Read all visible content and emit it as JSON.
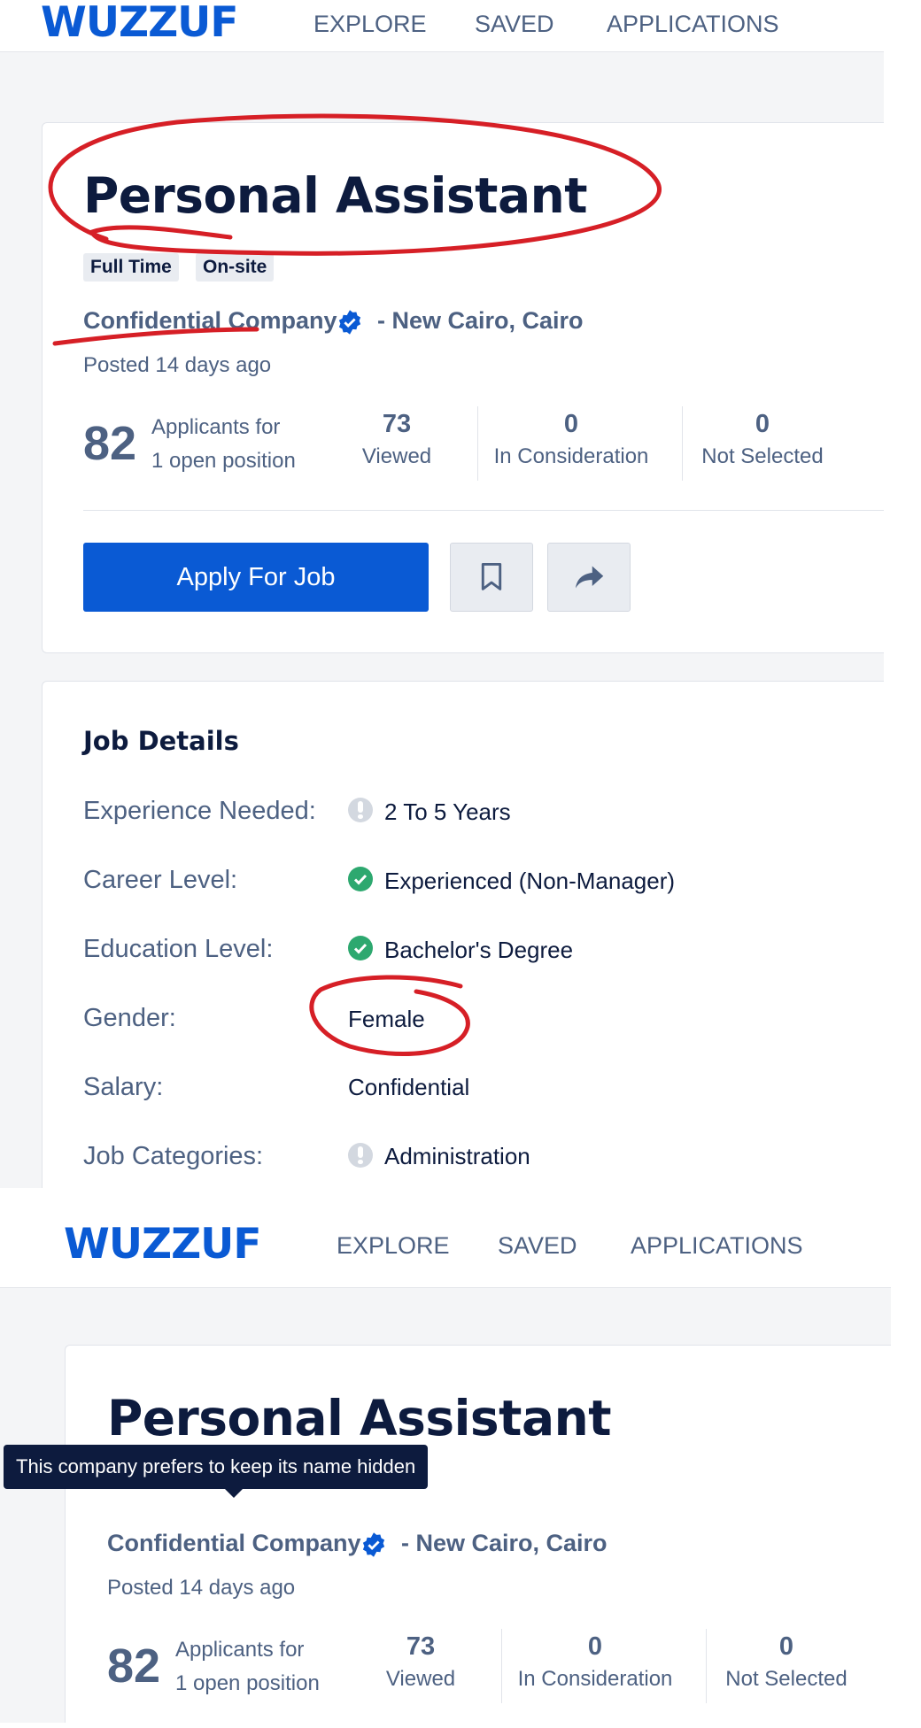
{
  "header": {
    "logo": "WUZZUF",
    "nav": [
      "EXPLORE",
      "SAVED",
      "APPLICATIONS"
    ]
  },
  "job": {
    "title": "Personal Assistant",
    "tags": [
      "Full Time",
      "On-site"
    ],
    "company": "Confidential Company",
    "location": "- New Cairo, Cairo",
    "posted": "Posted 14 days ago",
    "applicants_count": "82",
    "applicants_line1": "Applicants for",
    "applicants_line2": "1 open position",
    "stats": [
      {
        "value": "73",
        "label": "Viewed"
      },
      {
        "value": "0",
        "label": "In Consideration"
      },
      {
        "value": "0",
        "label": "Not Selected"
      }
    ],
    "apply_label": "Apply For Job"
  },
  "details": {
    "title": "Job Details",
    "rows": [
      {
        "label": "Experience Needed:",
        "value": "2 To 5 Years",
        "icon": "exclamation-icon"
      },
      {
        "label": "Career Level:",
        "value": "Experienced (Non-Manager)",
        "icon": "check-icon"
      },
      {
        "label": "Education Level:",
        "value": "Bachelor's Degree",
        "icon": "check-icon"
      },
      {
        "label": "Gender:",
        "value": "Female",
        "icon": ""
      },
      {
        "label": "Salary:",
        "value": "Confidential",
        "icon": ""
      },
      {
        "label": "Job Categories:",
        "value": "Administration",
        "icon": "exclamation-icon"
      }
    ]
  },
  "tooltip": "This company prefers to keep its name hidden",
  "colors": {
    "brand": "#0a5ad4",
    "annotation": "#d61f26",
    "check": "#2da86f"
  }
}
